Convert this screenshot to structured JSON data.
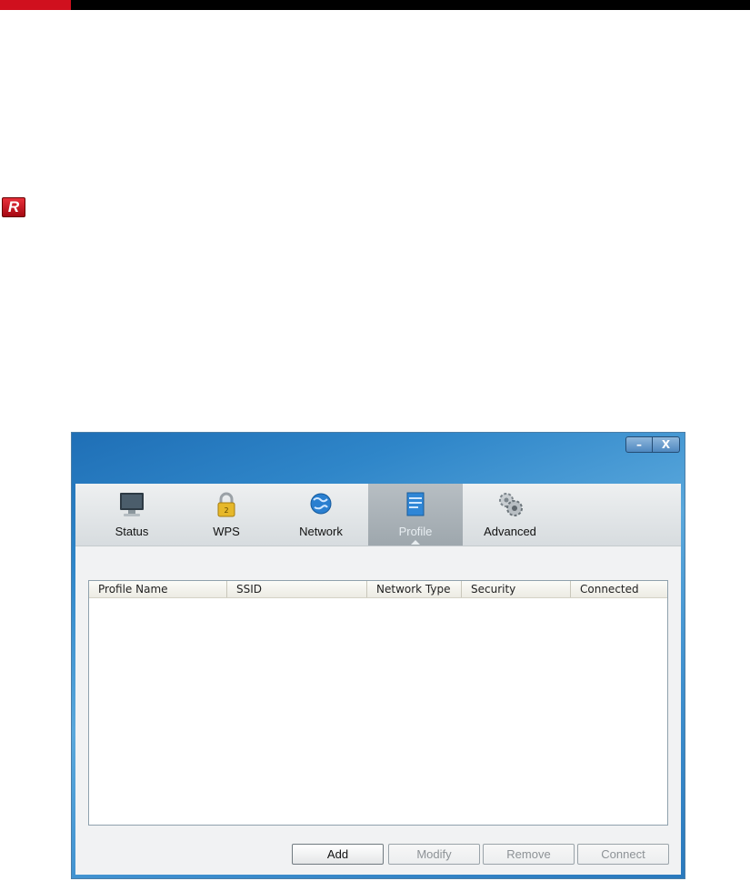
{
  "document": {
    "logo_letter": "R",
    "accent_color": "#d0101e"
  },
  "window": {
    "controls": {
      "minimize": "–",
      "close": "X"
    }
  },
  "toolbar": {
    "tabs": [
      {
        "label": "Status",
        "icon": "monitor-icon",
        "active": false
      },
      {
        "label": "WPS",
        "icon": "padlock-icon",
        "active": false
      },
      {
        "label": "Network",
        "icon": "globe-icon",
        "active": false
      },
      {
        "label": "Profile",
        "icon": "profile-document-icon",
        "active": true
      },
      {
        "label": "Advanced",
        "icon": "gears-icon",
        "active": false
      }
    ]
  },
  "profile_table": {
    "columns": [
      "Profile Name",
      "SSID",
      "Network Type",
      "Security",
      "Connected"
    ],
    "rows": []
  },
  "actions": {
    "add": "Add",
    "modify": "Modify",
    "remove": "Remove",
    "connect": "Connect"
  }
}
